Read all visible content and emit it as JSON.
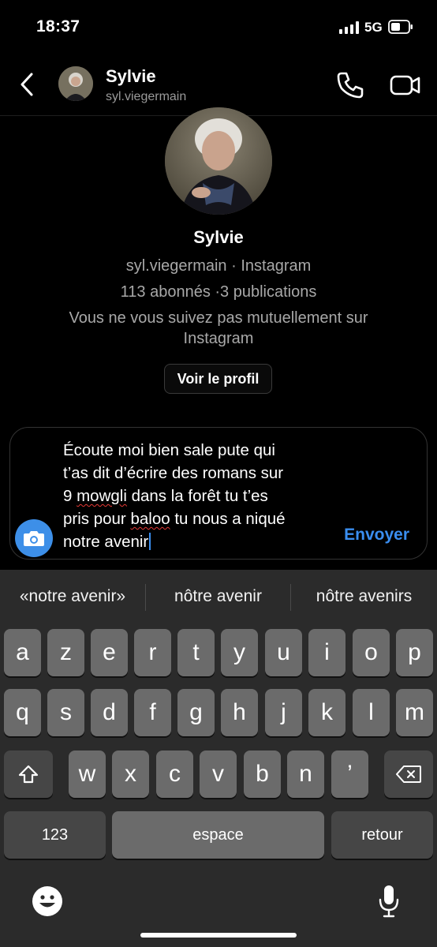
{
  "status_bar": {
    "time": "18:37",
    "network": "5G"
  },
  "header": {
    "name": "Sylvie",
    "username": "syl.viegermain"
  },
  "profile": {
    "name": "Sylvie",
    "subtitle": "syl.viegermain · Instagram",
    "stats": "113 abonnés ·3 publications",
    "mutual_line1": "Vous ne vous suivez pas mutuellement sur",
    "mutual_line2": "Instagram",
    "view_profile_label": "Voir le profil"
  },
  "composer": {
    "lines": [
      "Écoute moi bien sale pute qui",
      "t’as dit d’écrire des romans sur",
      "9 ",
      "mowgli",
      " dans la forêt tu t’es",
      "pris pour ",
      "baloo",
      " tu nous a niqué",
      "notre avenir"
    ],
    "send_label": "Envoyer"
  },
  "keyboard": {
    "suggestions": [
      "«notre avenir»",
      "nôtre avenir",
      "nôtre avenirs"
    ],
    "row1": [
      "a",
      "z",
      "e",
      "r",
      "t",
      "y",
      "u",
      "i",
      "o",
      "p"
    ],
    "row2": [
      "q",
      "s",
      "d",
      "f",
      "g",
      "h",
      "j",
      "k",
      "l",
      "m"
    ],
    "row3": [
      "w",
      "x",
      "c",
      "v",
      "b",
      "n",
      "’"
    ],
    "numbers_label": "123",
    "space_label": "espace",
    "return_label": "retour"
  },
  "colors": {
    "accent": "#3a8ef0",
    "camera_button": "#3d8fe8",
    "keyboard_bg": "#2b2b2b"
  }
}
